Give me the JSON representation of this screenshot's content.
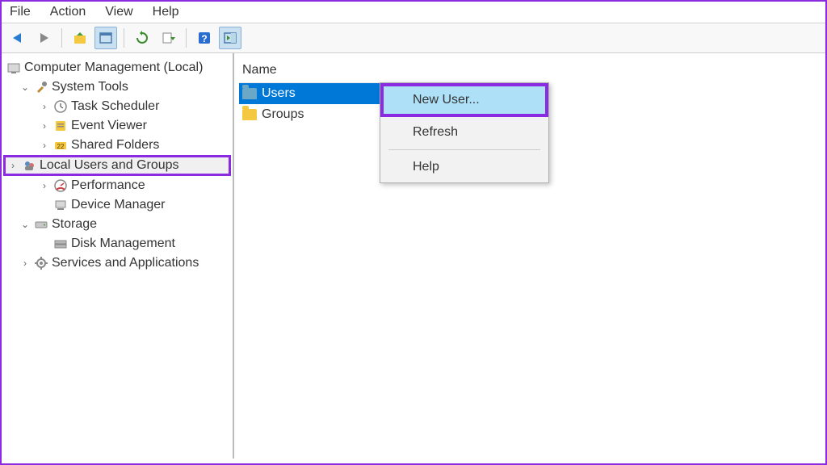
{
  "menubar": {
    "file": "File",
    "action": "Action",
    "view": "View",
    "help": "Help"
  },
  "tree": {
    "root": "Computer Management (Local)",
    "system_tools": "System Tools",
    "task_scheduler": "Task Scheduler",
    "event_viewer": "Event Viewer",
    "shared_folders": "Shared Folders",
    "local_users_groups": "Local Users and Groups",
    "performance": "Performance",
    "device_manager": "Device Manager",
    "storage": "Storage",
    "disk_management": "Disk Management",
    "services_apps": "Services and Applications"
  },
  "list": {
    "header": "Name",
    "items": [
      {
        "label": "Users",
        "selected": true
      },
      {
        "label": "Groups",
        "selected": false
      }
    ]
  },
  "context_menu": {
    "new_user": "New User...",
    "refresh": "Refresh",
    "help": "Help"
  }
}
